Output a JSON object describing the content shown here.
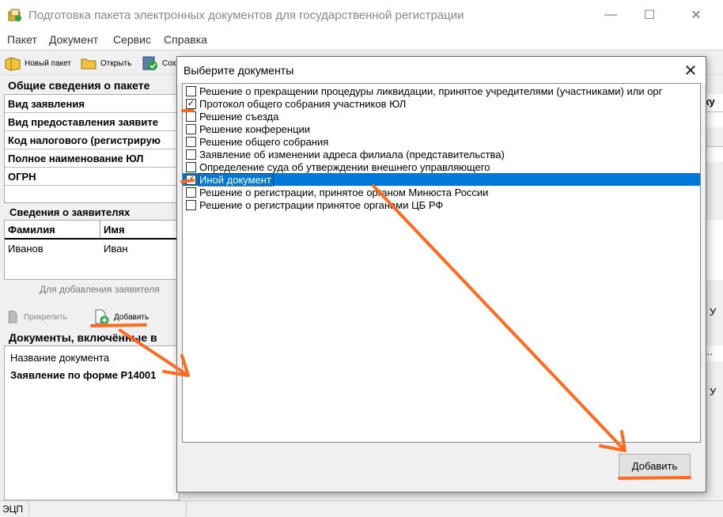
{
  "window": {
    "title": "Подготовка пакета электронных документов для государственной регистрации",
    "minimize": "—",
    "maximize": "☐",
    "close": "✕"
  },
  "menu": [
    "Пакет",
    "Документ",
    "Сервис",
    "Справка"
  ],
  "toolbar": {
    "new_package": "Новый пакет",
    "open": "Открыть",
    "save": "Сохр"
  },
  "general": {
    "heading": "Общие сведения о пакете",
    "rows": [
      "Вид заявления",
      "Вид предоставления заявите",
      "Код налогового (регистрирую",
      "Полное наименование ЮЛ",
      "ОГРН"
    ]
  },
  "applicants": {
    "heading": "Сведения о заявителях",
    "columns": [
      "Фамилия",
      "Имя"
    ],
    "row": [
      "Иванов",
      "Иван"
    ],
    "hint": "Для добавления заявителя"
  },
  "attach": {
    "attach_label": "Прикрепить",
    "add_label": "Добавить"
  },
  "documents": {
    "heading": "Документы, включённые в",
    "column": "Название документа",
    "row": "Заявление по форме Р14001"
  },
  "right_sliver": {
    "a": "ку",
    "b": "У",
    "c": "...",
    "d": "У"
  },
  "status": {
    "label": "ЭЦП"
  },
  "dialog": {
    "title": "Выберите документы",
    "close": "✕",
    "add_button": "Добавить",
    "items": [
      {
        "label": "Решение о прекращении процедуры ликвидации, принятое учредителями (участниками) или орг",
        "checked": false
      },
      {
        "label": "Протокол общего собрания участников ЮЛ",
        "checked": true
      },
      {
        "label": "Решение съезда",
        "checked": false
      },
      {
        "label": "Решение конференции",
        "checked": false
      },
      {
        "label": "Решение общего собрания",
        "checked": false
      },
      {
        "label": "Заявление об изменении адреса филиала (представительства)",
        "checked": false
      },
      {
        "label": "Определение суда об утверждении внешнего управляющего",
        "checked": false
      },
      {
        "label": "Иной документ",
        "checked": true,
        "selected": true
      },
      {
        "label": "Решение о регистрации, принятое органом Минюста России",
        "checked": false
      },
      {
        "label": "Решение о регистрации принятое органами ЦБ РФ",
        "checked": false
      }
    ]
  },
  "colors": {
    "selection": "#0078d7",
    "annotation": "#ff6a1f"
  }
}
